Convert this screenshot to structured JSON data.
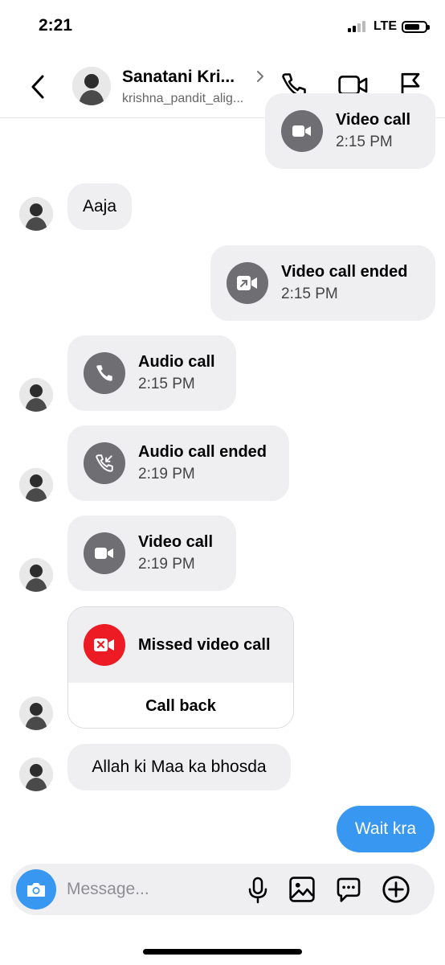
{
  "status_bar": {
    "time": "2:21",
    "network": "LTE"
  },
  "header": {
    "name": "Sanatani Kri...",
    "handle": "krishna_pandit_alig..."
  },
  "messages": {
    "top_video": {
      "title": "Video call",
      "time": "2:15 PM"
    },
    "aaja": "Aaja",
    "video_ended": {
      "title": "Video call ended",
      "time": "2:15 PM"
    },
    "audio_call": {
      "title": "Audio call",
      "time": "2:15 PM"
    },
    "audio_ended": {
      "title": "Audio call ended",
      "time": "2:19 PM"
    },
    "video_call2": {
      "title": "Video call",
      "time": "2:19 PM"
    },
    "missed": {
      "title": "Missed video call",
      "action": "Call back"
    },
    "allah": "Allah ki Maa ka bhosda",
    "wait": "Wait kra"
  },
  "composer": {
    "placeholder": "Message..."
  },
  "colors": {
    "accent": "#3897f0",
    "missed": "#ed1c24",
    "bubble": "#efeff1",
    "call_icon_bg": "#6e6e73"
  }
}
